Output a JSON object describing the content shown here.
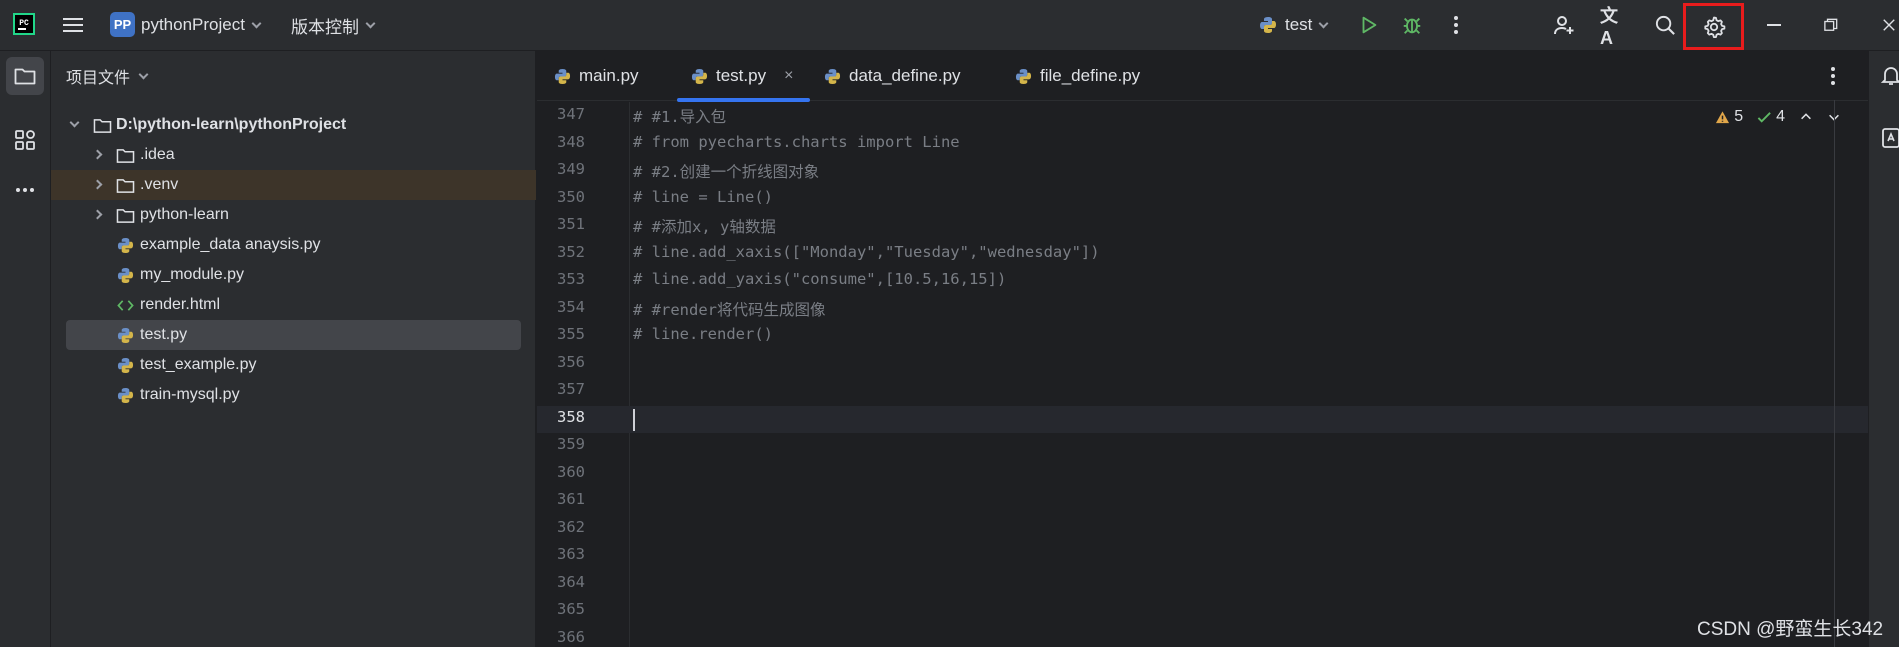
{
  "titlebar": {
    "project_badge": "PP",
    "project_name": "pythonProject",
    "vcs_label": "版本控制",
    "run_config": "test",
    "translate_glyph": "文A",
    "logo_text": "PC"
  },
  "project_panel": {
    "header": "项目文件",
    "tree": [
      {
        "label": "D:\\python-learn\\pythonProject",
        "kind": "root-folder",
        "expanded": true
      },
      {
        "label": ".idea",
        "kind": "folder"
      },
      {
        "label": ".venv",
        "kind": "folder",
        "highlight": "venv"
      },
      {
        "label": "python-learn",
        "kind": "folder"
      },
      {
        "label": "example_data anaysis.py",
        "kind": "python-file"
      },
      {
        "label": "my_module.py",
        "kind": "python-file"
      },
      {
        "label": "render.html",
        "kind": "html-file"
      },
      {
        "label": "test.py",
        "kind": "python-file",
        "selected": true
      },
      {
        "label": "test_example.py",
        "kind": "python-file"
      },
      {
        "label": "train-mysql.py",
        "kind": "python-file"
      }
    ]
  },
  "editor": {
    "tabs": [
      {
        "label": "main.py",
        "active": false
      },
      {
        "label": "test.py",
        "active": true,
        "close": "×"
      },
      {
        "label": "data_define.py",
        "active": false
      },
      {
        "label": "file_define.py",
        "active": false
      }
    ],
    "inspections": {
      "warnings": "5",
      "weak_warnings": "4"
    },
    "current_line": "358",
    "lines": [
      {
        "no": "347",
        "text": "# #1.导入包"
      },
      {
        "no": "348",
        "text": "# from pyecharts.charts import Line"
      },
      {
        "no": "349",
        "text": "# #2.创建一个折线图对象"
      },
      {
        "no": "350",
        "text": "# line = Line()"
      },
      {
        "no": "351",
        "text": "# #添加x, y轴数据"
      },
      {
        "no": "352",
        "text": "# line.add_xaxis([\"Monday\",\"Tuesday\",\"wednesday\"])"
      },
      {
        "no": "353",
        "text": "# line.add_yaxis(\"consume\",[10.5,16,15])"
      },
      {
        "no": "354",
        "text": "# #render将代码生成图像"
      },
      {
        "no": "355",
        "text": "# line.render()"
      },
      {
        "no": "356",
        "text": ""
      },
      {
        "no": "357",
        "text": ""
      },
      {
        "no": "358",
        "text": ""
      },
      {
        "no": "359",
        "text": ""
      },
      {
        "no": "360",
        "text": ""
      },
      {
        "no": "361",
        "text": ""
      },
      {
        "no": "362",
        "text": ""
      },
      {
        "no": "363",
        "text": ""
      },
      {
        "no": "364",
        "text": ""
      },
      {
        "no": "365",
        "text": ""
      },
      {
        "no": "366",
        "text": ""
      }
    ]
  },
  "watermark": "CSDN @野蛮生长342",
  "colors": {
    "accent": "#3574f0",
    "highlight_box": "#e81c1c",
    "run_green": "#5fb865",
    "background": "#1e1f22",
    "panel": "#2b2d30"
  },
  "icons": [
    "pycharm-logo-icon",
    "main-menu-icon",
    "chevron-down-icon",
    "python-icon",
    "run-icon",
    "debug-icon",
    "more-icon",
    "add-user-icon",
    "translate-icon",
    "search-icon",
    "settings-icon",
    "minimize-icon",
    "restore-icon",
    "close-icon",
    "folder-icon",
    "structure-icon",
    "notifications-icon",
    "warning-icon",
    "check-icon"
  ]
}
